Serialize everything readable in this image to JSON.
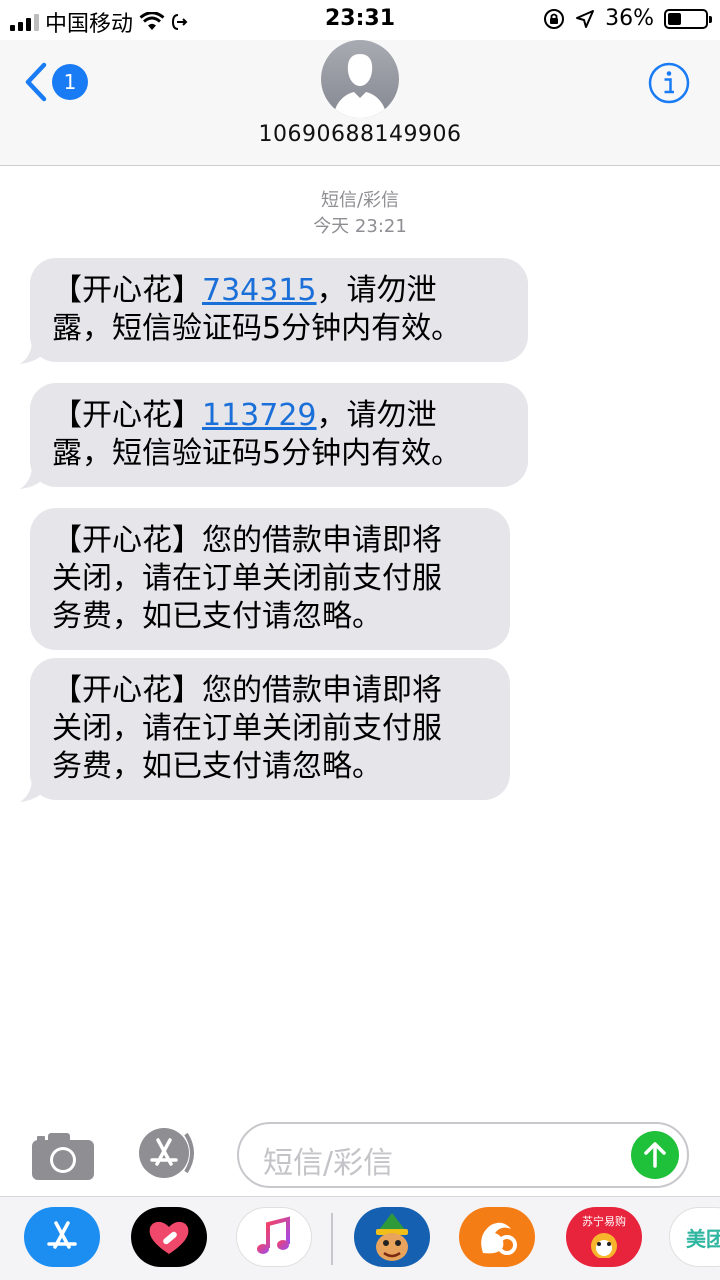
{
  "status_bar": {
    "carrier": "中国移动",
    "time": "23:31",
    "battery": "36%",
    "battery_level": 0.36
  },
  "header": {
    "back_badge": "1",
    "contact": "10690688149906",
    "icons": [
      "chevron-left-icon",
      "contact-avatar",
      "info-icon"
    ]
  },
  "thread": {
    "service": "短信/彩信",
    "date": "今天 23:21",
    "messages": [
      {
        "prefix": "【开心花】",
        "code": "734315",
        "line1_rest": "，请勿泄",
        "line2": "露，短信验证码5分钟内有效。"
      },
      {
        "prefix": "【开心花】",
        "code": "113729",
        "line1_rest": "，请勿泄",
        "line2": "露，短信验证码5分钟内有效。"
      },
      {
        "line1": "【开心花】您的借款申请即将",
        "line2": "关闭，请在订单关闭前支付服",
        "line3": "务费，如已支付请忽略。"
      },
      {
        "line1": "【开心花】您的借款申请即将",
        "line2": "关闭，请在订单关闭前支付服",
        "line3": "务费，如已支付请忽略。"
      }
    ]
  },
  "composer": {
    "placeholder": "短信/彩信",
    "icons": [
      "camera-icon",
      "app-store-icon",
      "send-arrow-icon"
    ]
  },
  "app_drawer": {
    "apps": [
      {
        "name": "app-store",
        "color": "#1c8ef2"
      },
      {
        "name": "heart-app",
        "color": "#000000"
      },
      {
        "name": "music",
        "color": "#ffffff"
      },
      {
        "name": "elf-game",
        "color": "#1560b0"
      },
      {
        "name": "uc-browser",
        "color": "#f57d16"
      },
      {
        "name": "suning",
        "label": "苏宁易购",
        "color": "#e8243c"
      },
      {
        "name": "meituan",
        "label": "美团",
        "color": "#ffffff"
      }
    ]
  },
  "colors": {
    "accent": "#1a7cf5",
    "bubble": "#e5e5ea",
    "send": "#20c13a",
    "link": "#1a6fd8"
  }
}
